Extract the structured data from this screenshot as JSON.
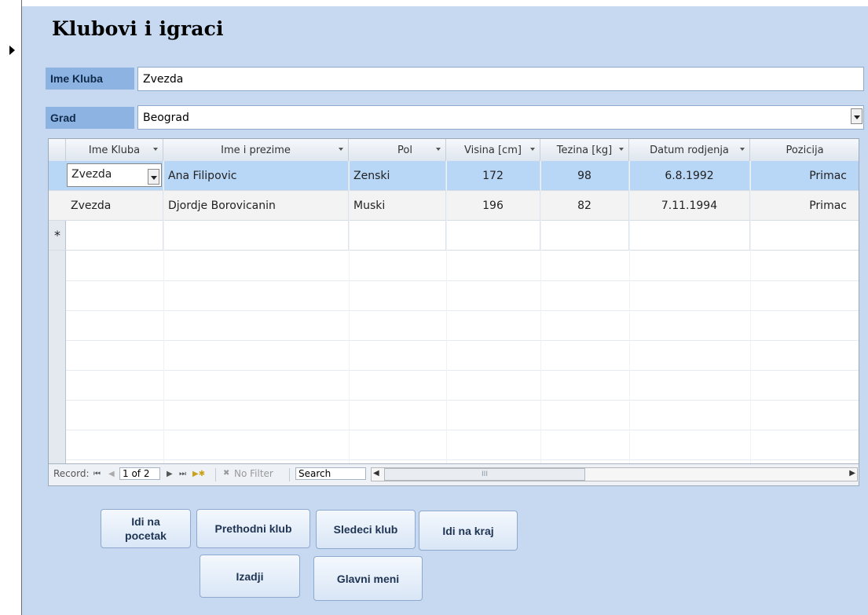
{
  "form": {
    "title": "Klubovi i igraci",
    "ime_kluba_label": "Ime Kluba",
    "ime_kluba_value": "Zvezda",
    "grad_label": "Grad",
    "grad_value": "Beograd"
  },
  "table": {
    "headers": [
      "Ime Kluba",
      "Ime i prezime",
      "Pol",
      "Visina [cm]",
      "Tezina [kg]",
      "Datum rodjenja",
      "Pozicija"
    ],
    "rows": [
      [
        "Zvezda",
        "Ana Filipovic",
        "Zenski",
        "172",
        "98",
        "6.8.1992",
        "Primac"
      ],
      [
        "Zvezda",
        "Djordje Borovicanin",
        "Muski",
        "196",
        "82",
        "7.11.1994",
        "Primac"
      ]
    ],
    "new_row_marker": "*"
  },
  "navigation": {
    "record_label": "Record:",
    "first": "⏮",
    "prev": "◀",
    "position": "1 of 2",
    "next": "▶",
    "last": "⏭",
    "new": "▶✱",
    "filter": "No Filter",
    "search": "Search",
    "scroll_left": "◀",
    "scroll_right": "▶",
    "scroll_thumb": "III"
  },
  "buttons": {
    "first": "Idi na\npocetak",
    "prev": "Prethodni klub",
    "next": "Sledeci klub",
    "last": "Idi na kraj",
    "exit": "Izadji",
    "main": "Glavni meni"
  }
}
